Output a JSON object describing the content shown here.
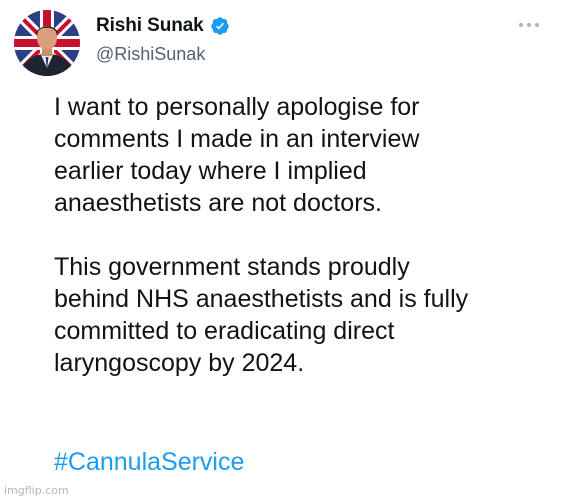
{
  "author": {
    "display_name": "Rishi Sunak",
    "handle": "@RishiSunak",
    "verified": true,
    "verified_color": "#1d9bf0",
    "avatar_icon": "profile-photo"
  },
  "menu": {
    "icon": "more-horizontal-icon"
  },
  "tweet": {
    "paragraphs": [
      [
        "I want to personally apologise for",
        "comments I made in an interview",
        "earlier today where I implied",
        "anaesthetists are not doctors."
      ],
      [
        "This government stands proudly",
        "behind NHS anaesthetists and is fully",
        "committed to eradicating direct",
        "laryngoscopy by 2024."
      ]
    ],
    "hashtag": "#CannulaService",
    "hashtag_color": "#1d9bf0"
  },
  "watermark": "imgflip.com"
}
